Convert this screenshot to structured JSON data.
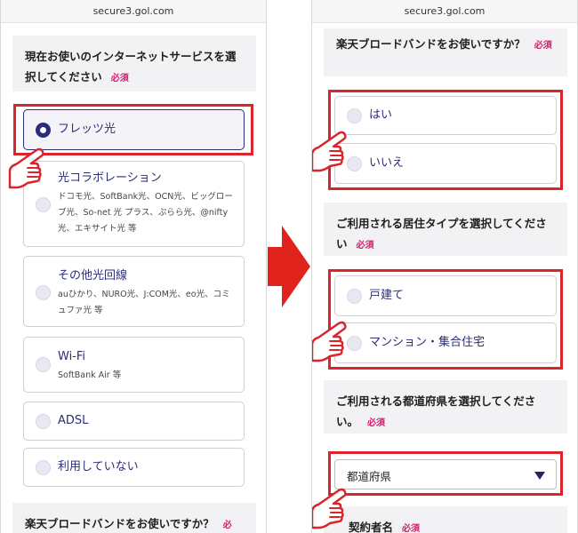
{
  "left": {
    "url": "secure3.gol.com",
    "question1": {
      "title": "現在お使いのインターネットサービスを選択してください",
      "required": "必須"
    },
    "options": [
      {
        "label": "フレッツ光",
        "sub": "",
        "selected": true
      },
      {
        "label": "光コラボレーション",
        "sub": "ドコモ光、SoftBank光、OCN光、ビッグローブ光、So-net 光 プラス、ぷらら光、@nifty光、エキサイト光 等",
        "selected": false
      },
      {
        "label": "その他光回線",
        "sub": "auひかり、NURO光、J:COM光、eo光、コミュファ光 等",
        "selected": false
      },
      {
        "label": "Wi-Fi",
        "sub": "SoftBank Air 等",
        "selected": false
      },
      {
        "label": "ADSL",
        "sub": "",
        "selected": false
      },
      {
        "label": "利用していない",
        "sub": "",
        "selected": false
      }
    ],
    "question2": {
      "title": "楽天ブロードバンドをお使いですか？",
      "required": "必"
    }
  },
  "right": {
    "url": "secure3.gol.com",
    "q_rakuten": {
      "title": "楽天ブロードバンドをお使いですか？",
      "required": "必須"
    },
    "rakuten_options": [
      "はい",
      "いいえ"
    ],
    "q_residence": {
      "title": "ご利用される居住タイプを選択してください",
      "required": "必須"
    },
    "residence_options": [
      "戸建て",
      "マンション・集合住宅"
    ],
    "q_prefecture": {
      "title": "ご利用される都道府県を選択してください。",
      "required": "必須"
    },
    "prefecture_select": {
      "value": "都道府県"
    },
    "q_name": {
      "title": "契約者名",
      "required": "必須"
    }
  },
  "colors": {
    "accent": "#2b2d77",
    "highlight": "#d9252b",
    "required": "#d3206e",
    "question_bg": "#f2f2f5"
  }
}
